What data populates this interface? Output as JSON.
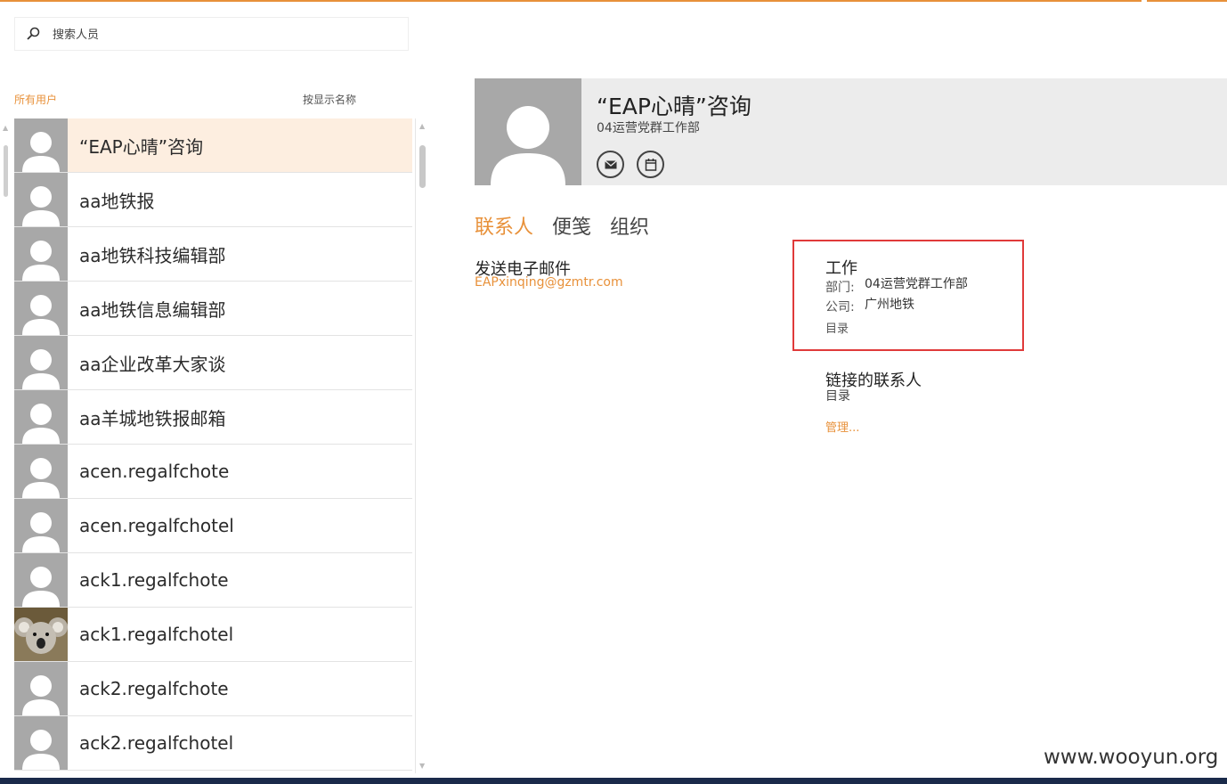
{
  "search": {
    "placeholder": "搜索人员"
  },
  "filter": {
    "all_users": "所有用户",
    "sort_by": "按显示名称"
  },
  "contacts": [
    {
      "name": "“EAP心晴”咨询",
      "selected": true,
      "avatar": "default-person"
    },
    {
      "name": "aa地铁报",
      "avatar": "default-person"
    },
    {
      "name": "aa地铁科技编辑部",
      "avatar": "default-person"
    },
    {
      "name": "aa地铁信息编辑部",
      "avatar": "default-person"
    },
    {
      "name": "aa企业改革大家谈",
      "avatar": "default-person"
    },
    {
      "name": "aa羊城地铁报邮箱",
      "avatar": "default-person"
    },
    {
      "name": "acen.regalfchote",
      "avatar": "default-person"
    },
    {
      "name": "acen.regalfchotel",
      "avatar": "default-person"
    },
    {
      "name": "ack1.regalfchote",
      "avatar": "default-person"
    },
    {
      "name": "ack1.regalfchotel",
      "avatar": "koala-photo"
    },
    {
      "name": "ack2.regalfchote",
      "avatar": "default-person"
    },
    {
      "name": "ack2.regalfchotel",
      "avatar": "default-person"
    }
  ],
  "detail": {
    "name": "“EAP心晴”咨询",
    "department": "04运营党群工作部",
    "actions": [
      "mail-icon",
      "calendar-icon"
    ],
    "tabs": [
      "联系人",
      "便笺",
      "组织"
    ],
    "email_label": "发送电子邮件",
    "email": "EAPxinqing@gzmtr.com",
    "work": {
      "title": "工作",
      "dept_key": "部门:",
      "dept_val": "04运营党群工作部",
      "company_key": "公司:",
      "company_val": "广州地铁",
      "source": "目录"
    },
    "linked": {
      "title": "链接的联系人",
      "source": "目录",
      "manage": "管理..."
    }
  },
  "watermark": "www.wooyun.org",
  "colors": {
    "accent": "#e8913a",
    "highlight_border": "#e03a3a",
    "avatar_bg": "#a8a8a8"
  }
}
